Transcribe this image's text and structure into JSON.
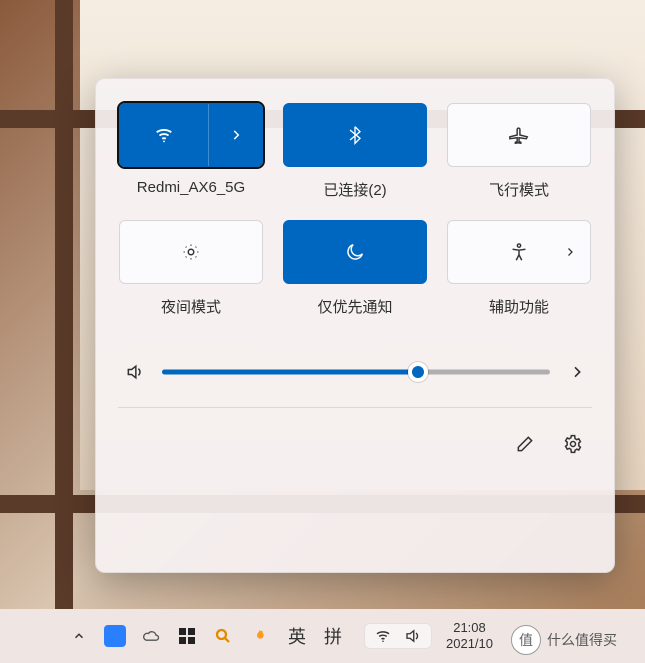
{
  "quick_settings": {
    "tiles": {
      "wifi": {
        "label": "Redmi_AX6_5G",
        "active": true
      },
      "bluetooth": {
        "label": "已连接(2)",
        "active": true
      },
      "airplane": {
        "label": "飞行模式",
        "active": false
      },
      "night": {
        "label": "夜间模式",
        "active": false
      },
      "focus": {
        "label": "仅优先通知",
        "active": true
      },
      "accessibility": {
        "label": "辅助功能",
        "active": false
      }
    },
    "volume": {
      "percent": 66
    }
  },
  "taskbar": {
    "ime": {
      "lang": "英",
      "mode": "拼"
    },
    "clock": {
      "time": "21:08",
      "date": "2021/10"
    }
  },
  "watermark": {
    "logo": "值",
    "text": "什么值得买"
  },
  "colors": {
    "accent": "#0067C0"
  }
}
